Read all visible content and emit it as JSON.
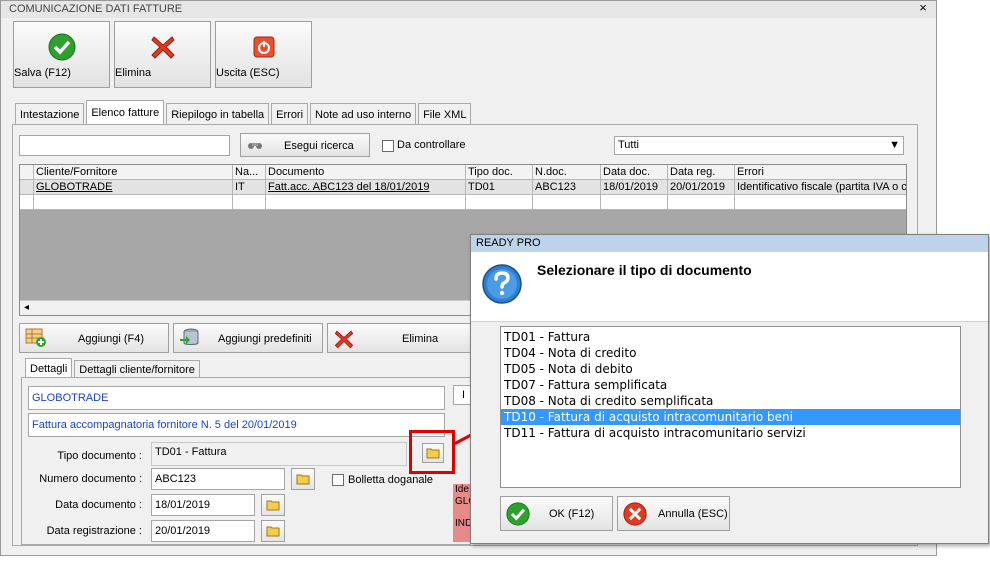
{
  "window": {
    "title": "COMUNICAZIONE DATI FATTURE",
    "close_glyph": "×"
  },
  "toolbar": [
    {
      "label": "Salva (F12)",
      "icon": "check-icon"
    },
    {
      "label": "Elimina",
      "icon": "delete-x-icon"
    },
    {
      "label": "Uscita (ESC)",
      "icon": "power-icon"
    }
  ],
  "tabs": [
    "Intestazione",
    "Elenco fatture",
    "Riepilogo in tabella",
    "Errori",
    "Note ad uso interno",
    "File XML"
  ],
  "active_tab": "Elenco fatture",
  "search": {
    "value": "",
    "button_label": "Esegui ricerca",
    "checkbox_label": "Da controllare",
    "filter_value": "Tutti"
  },
  "grid": {
    "columns": [
      "Cliente/Fornitore",
      "Na...",
      "Documento",
      "Tipo doc.",
      "N.doc.",
      "Data doc.",
      "Data reg.",
      "Errori"
    ],
    "rows": [
      [
        "GLOBOTRADE",
        "IT",
        "Fatt.acc. ABC123 del 18/01/2019",
        "TD01",
        "ABC123",
        "18/01/2019",
        "20/01/2019",
        "Identificativo fiscale (partita IVA o c"
      ]
    ],
    "scroll_left_glyph": "◂"
  },
  "actions": [
    {
      "label": "Aggiungi (F4)",
      "icon": "add-grid-icon"
    },
    {
      "label": "Aggiungi predefiniti",
      "icon": "database-add-icon"
    },
    {
      "label": "Elimina",
      "icon": "delete-x-icon"
    }
  ],
  "detail_tabs": [
    "Dettagli",
    "Dettagli cliente/fornitore"
  ],
  "details": {
    "partner": "GLOBOTRADE",
    "description": "Fattura accompagnatoria fornitore N. 5 del 20/01/2019",
    "tipo_label": "Tipo documento :",
    "tipo_value": "TD01 - Fattura",
    "numero_label": "Numero documento :",
    "numero_value": "ABC123",
    "bolletta_label": "Bolletta doganale",
    "data_doc_label": "Data documento :",
    "data_doc_value": "18/01/2019",
    "data_reg_label": "Data registrazione :",
    "data_reg_value": "20/01/2019",
    "side_header": "I",
    "side_lines": [
      "Ide",
      "GLO",
      "IND"
    ]
  },
  "dialog": {
    "title": "READY PRO",
    "question": "Selezionare il tipo di documento",
    "options": [
      "TD01 - Fattura",
      "TD04 - Nota di credito",
      "TD05 - Nota di debito",
      "TD07 - Fattura semplificata",
      "TD08 - Nota di credito semplificata",
      "TD10 - Fattura di acquisto intracomunitario beni",
      "TD11 - Fattura di acquisto intracomunitario servizi"
    ],
    "selected_index": 5,
    "ok_label": "OK (F12)",
    "cancel_label": "Annulla (ESC)"
  },
  "colors": {
    "selection": "#3399ff",
    "highlight_red": "#e00000",
    "error_bg": "#e88a8a"
  }
}
